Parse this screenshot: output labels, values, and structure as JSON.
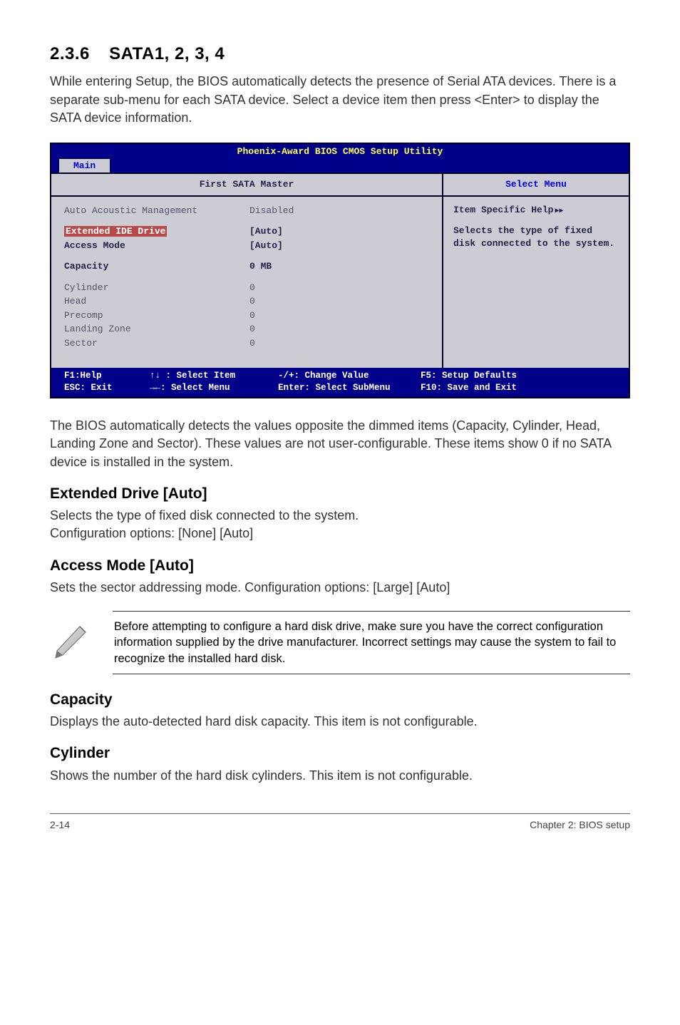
{
  "section": {
    "number": "2.3.6",
    "title": "SATA1, 2, 3, 4",
    "intro": "While entering Setup, the BIOS automatically detects the presence of Serial ATA devices. There is a separate sub-menu for each SATA device. Select a device item then press <Enter> to display the SATA device information."
  },
  "bios": {
    "utility_title": "Phoenix-Award BIOS CMOS Setup Utility",
    "tab": "Main",
    "panel_title_left": "First SATA Master",
    "panel_title_right": "Select Menu",
    "rows": {
      "aam_label": "Auto Acoustic Management",
      "aam_value": "Disabled",
      "ext_label": "Extended IDE Drive",
      "ext_value": "[Auto]",
      "access_label": "Access Mode",
      "access_value": "[Auto]",
      "capacity_label": "Capacity",
      "capacity_value": "0 MB",
      "cylinder_label": "Cylinder",
      "cylinder_value": "0",
      "head_label": "Head",
      "head_value": "0",
      "precomp_label": "Precomp",
      "precomp_value": "0",
      "landing_label": "Landing Zone",
      "landing_value": "0",
      "sector_label": "Sector",
      "sector_value": "0"
    },
    "help": {
      "title": "Item Specific Help",
      "desc": "Selects the type of fixed disk connected to the system."
    },
    "footer": {
      "f1": "F1:Help",
      "esc": "ESC: Exit",
      "updown": "↑↓ : Select Item",
      "leftright": "→←: Select Menu",
      "change": "-/+: Change Value",
      "submenu": "Enter: Select SubMenu",
      "defaults": "F5: Setup Defaults",
      "save": "F10: Save and Exit"
    }
  },
  "after_bios_para": "The BIOS automatically detects the values opposite the dimmed items (Capacity, Cylinder,  Head, Landing Zone and Sector). These values are not user-configurable. These items show 0 if no SATA device is installed in the system.",
  "ext_drive": {
    "heading": "Extended Drive [Auto]",
    "line1": "Selects the type of fixed disk connected to the system.",
    "line2": "Configuration options: [None] [Auto]"
  },
  "access_mode": {
    "heading": "Access Mode [Auto]",
    "line1": "Sets the sector addressing mode. Configuration options: [Large] [Auto]"
  },
  "note": "Before attempting to configure a hard disk drive, make sure you have the correct configuration information supplied by the drive manufacturer. Incorrect settings may cause the system to fail to recognize the installed hard disk.",
  "capacity": {
    "heading": "Capacity",
    "text": "Displays the auto-detected hard disk capacity. This item is not configurable."
  },
  "cylinder": {
    "heading": "Cylinder",
    "text": "Shows the number of the hard disk cylinders. This item is not configurable."
  },
  "page_footer": {
    "left": "2-14",
    "right": "Chapter 2: BIOS setup"
  }
}
